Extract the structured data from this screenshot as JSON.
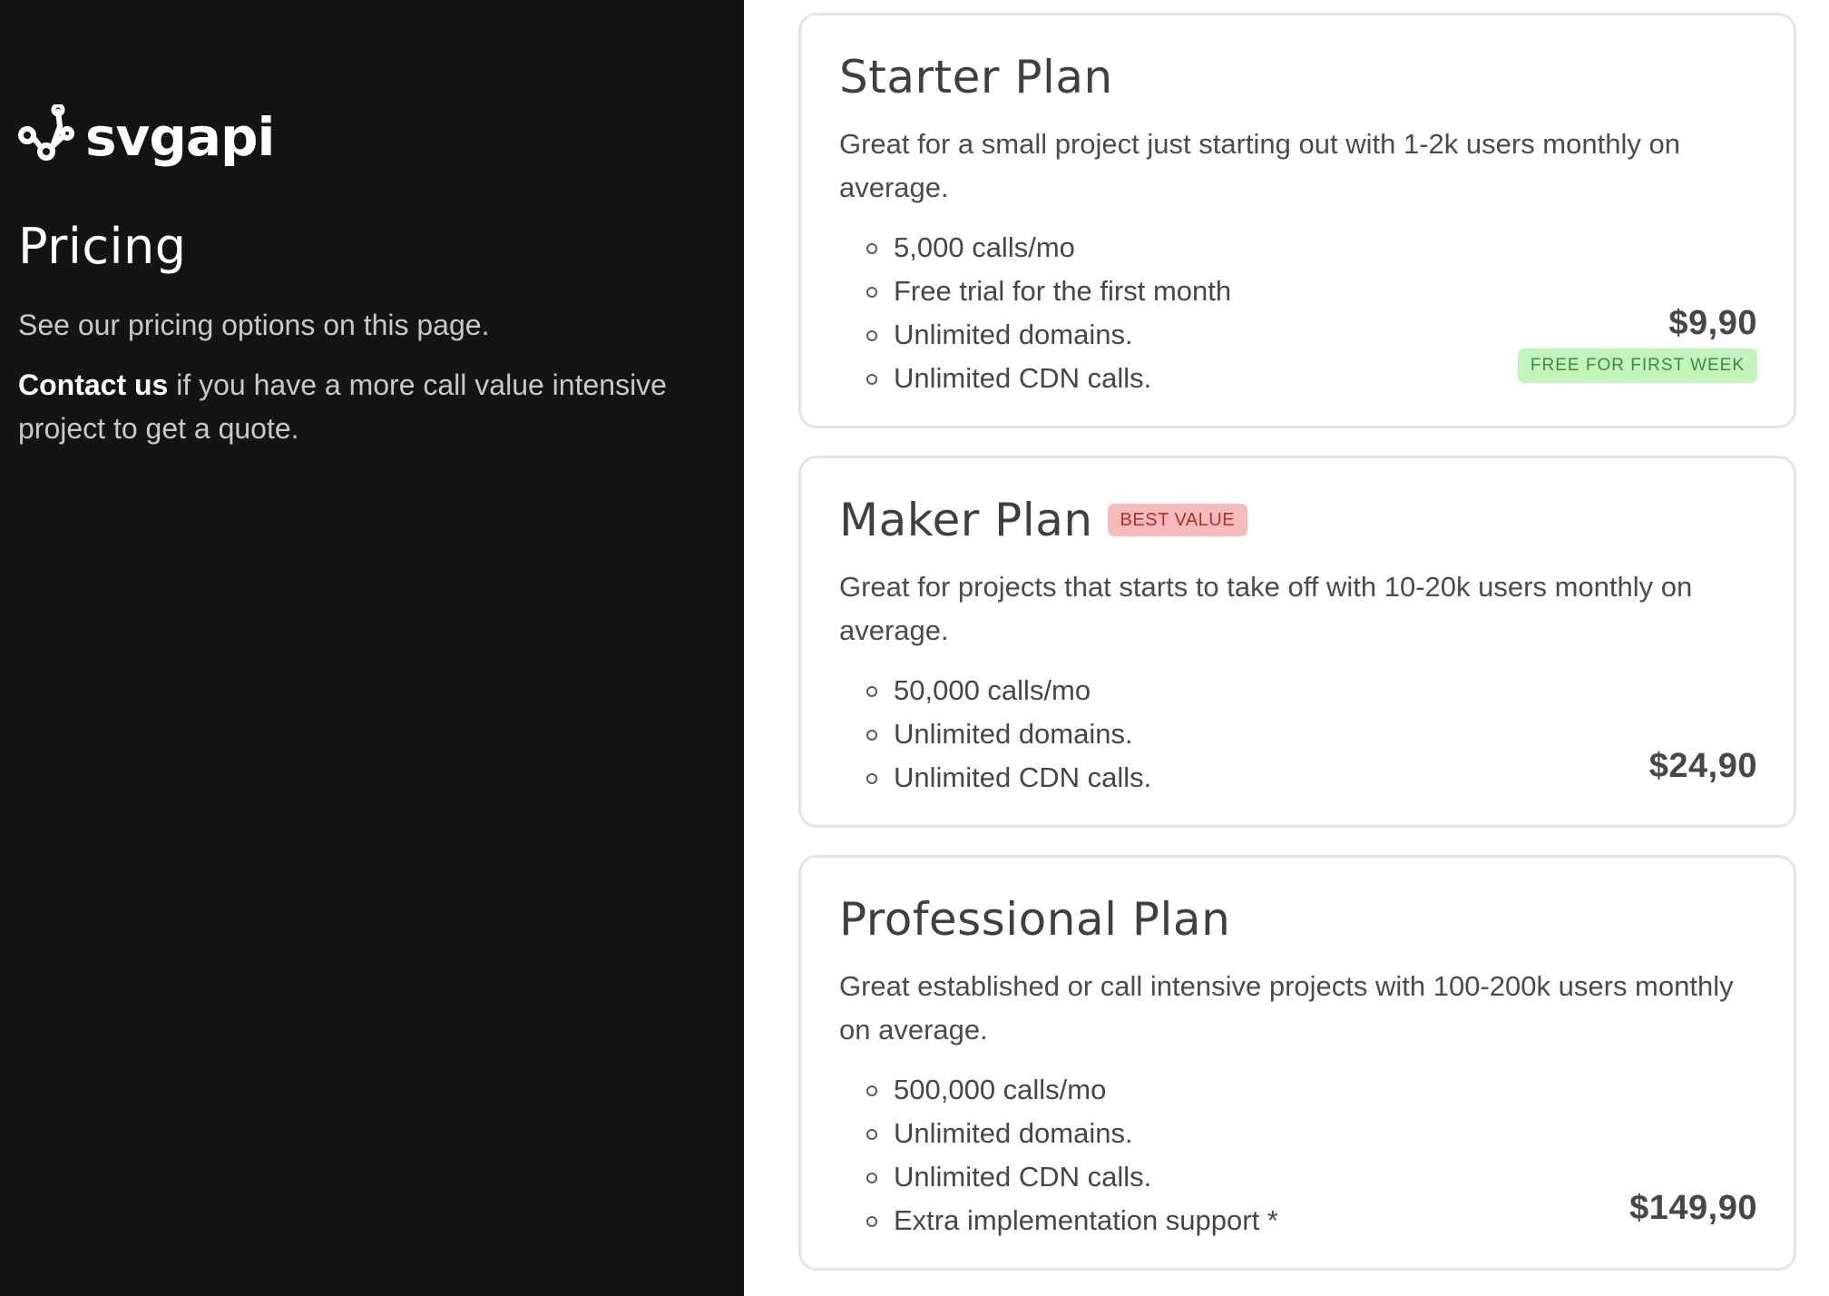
{
  "brand": {
    "name": "svgapi",
    "icon": "node-graph-icon"
  },
  "sidebar": {
    "title": "Pricing",
    "intro": "See our pricing options on this page.",
    "contact_link": "Contact us",
    "contact_text": " if you have a more call value intensive project to get a quote."
  },
  "plans": [
    {
      "name": "Starter Plan",
      "description": "Great for a small project just starting out with 1-2k users monthly on average.",
      "features": [
        "5,000 calls/mo",
        "Free trial for the first month",
        "Unlimited domains.",
        "Unlimited CDN calls."
      ],
      "price": "$9,90",
      "promo_badge": "FREE FOR FIRST WEEK"
    },
    {
      "name": "Maker Plan",
      "badge": "BEST VALUE",
      "description": "Great for projects that starts to take off with 10-20k users monthly on average.",
      "features": [
        "50,000 calls/mo",
        "Unlimited domains.",
        "Unlimited CDN calls."
      ],
      "price": "$24,90"
    },
    {
      "name": "Professional Plan",
      "description": "Great established or call intensive projects with 100-200k users monthly on average.",
      "features": [
        "500,000 calls/mo",
        "Unlimited domains.",
        "Unlimited CDN calls.",
        "Extra implementation support *"
      ],
      "price": "$149,90"
    }
  ],
  "colors": {
    "sidebar_bg": "#141414",
    "best_value_bg": "#f6bcbc",
    "best_value_text": "#b52c2c",
    "free_badge_bg": "#c4f3bd",
    "free_badge_text": "#3a8c3a"
  }
}
